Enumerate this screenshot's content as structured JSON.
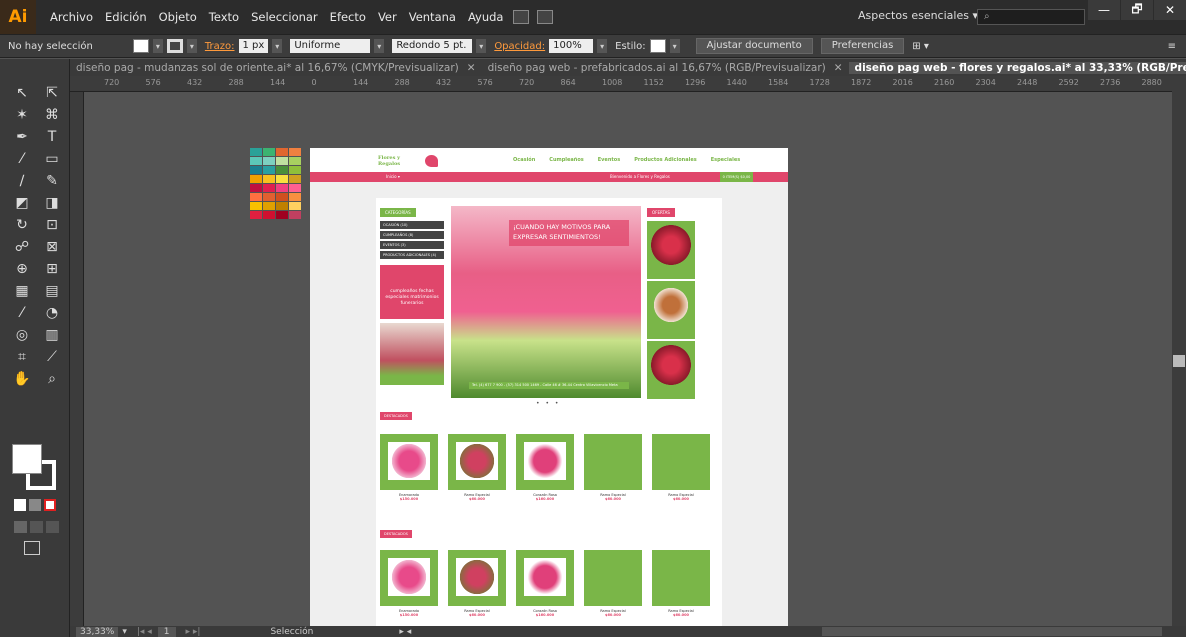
{
  "app": {
    "logo": "Ai"
  },
  "menu": [
    "Archivo",
    "Edición",
    "Objeto",
    "Texto",
    "Seleccionar",
    "Efecto",
    "Ver",
    "Ventana",
    "Ayuda"
  ],
  "workspace": "Aspectos esenciales",
  "window_controls": [
    "—",
    "🗗",
    "✕"
  ],
  "control_bar": {
    "selection": "No hay selección",
    "stroke_label": "Trazo:",
    "stroke_value": "1 px",
    "profile": "Uniforme",
    "brush": "Redondo 5 pt.",
    "opacity_label": "Opacidad:",
    "opacity_value": "100%",
    "style_label": "Estilo:",
    "adjust_button": "Ajustar documento",
    "prefs_button": "Preferencias"
  },
  "tabs": [
    {
      "label": "diseño pag - mudanzas sol de oriente.ai* al 16,67% (CMYK/Previsualizar)",
      "active": false
    },
    {
      "label": "diseño pag web - prefabricados.ai al 16,67% (RGB/Previsualizar)",
      "active": false
    },
    {
      "label": "diseño pag web - flores y regalos.ai* al 33,33% (RGB/Previsualizar)",
      "active": true
    }
  ],
  "ruler_ticks": [
    "720",
    "576",
    "432",
    "288",
    "144",
    "0",
    "144",
    "288",
    "432",
    "576",
    "720",
    "864",
    "1008",
    "1152",
    "1296",
    "1440",
    "1584",
    "1728",
    "1872",
    "2016",
    "2160",
    "2304",
    "2448",
    "2592",
    "2736",
    "2880"
  ],
  "status": {
    "zoom": "33,33%",
    "page": "1",
    "mode": "Selección"
  },
  "palette_colors": [
    "#2aa198",
    "#3cb371",
    "#e0662f",
    "#f08040",
    "#5cc8b8",
    "#7dd0c0",
    "#c0e0a0",
    "#a8d060",
    "#1a7f8f",
    "#2a9fa0",
    "#4a8f3a",
    "#8fbf3a",
    "#f0a000",
    "#f8c020",
    "#f8e040",
    "#d0a020",
    "#c01040",
    "#e02050",
    "#f04080",
    "#ff6090",
    "#ff7040",
    "#e06030",
    "#d05020",
    "#f89040",
    "#f8c000",
    "#e0a000",
    "#c08000",
    "#ffd060",
    "#e02040",
    "#d01030",
    "#a00020",
    "#c04060"
  ],
  "site": {
    "logo": "Flores y Regalos",
    "nav": [
      "Ocasión",
      "Cumpleaños",
      "Eventos",
      "Productos Adicionales",
      "Especiales"
    ],
    "topbar_left": "Inicio ▾",
    "topbar_right": "Bienvenido a Flores y Regalos",
    "cart": "0 ITEM(S) $0,00",
    "categories_tag": "CATEGORÍAS",
    "categories": [
      "OCASIÓN (10)",
      "CUMPLEAÑOS (8)",
      "EVENTOS (3)",
      "PRODUCTOS ADICIONALES (4)"
    ],
    "promo_text": "cumpleaños fechas especiales matrimonios funerarios",
    "hero_text": "¡CUANDO HAY MOTIVOS PARA EXPRESAR SENTIMIENTOS!",
    "hero_footer": "Tel. (4) 677 7 900 - (57) 314 500 1469 - Calle 46 # 36-44 Centro Villavicencio Meta",
    "offers_tag": "OFERTAS",
    "slider_dots": "• • •",
    "featured_tag": "DESTACADOS",
    "products": [
      {
        "name": "Enamorado",
        "price": "$150.000"
      },
      {
        "name": "Ramo Especial",
        "price": "$60.000"
      },
      {
        "name": "Corazón Rosa",
        "price": "$160.000"
      },
      {
        "name": "Ramo Especial",
        "price": "$60.000"
      },
      {
        "name": "Ramo Especial",
        "price": "$60.000"
      }
    ]
  }
}
